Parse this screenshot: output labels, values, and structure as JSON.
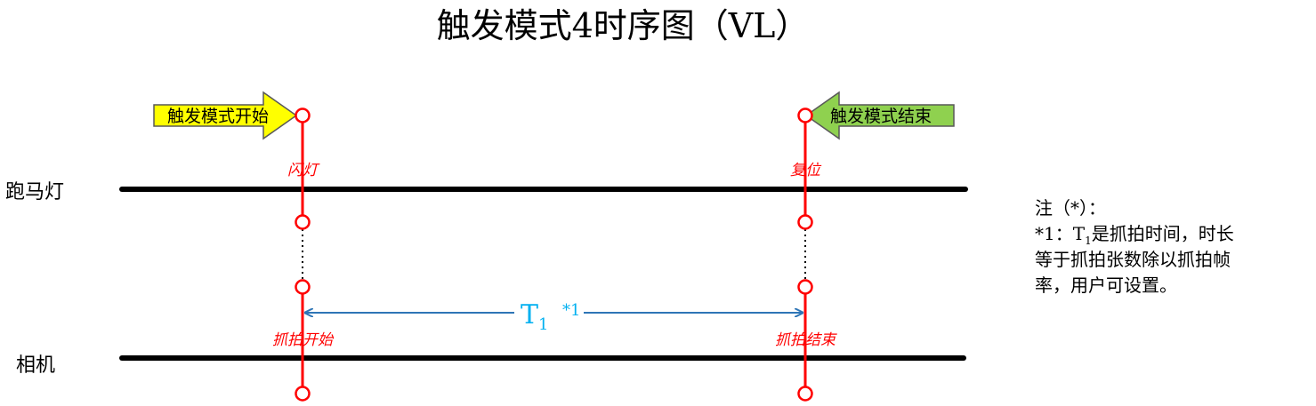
{
  "title": "触发模式4时序图（VL）",
  "arrows": {
    "start": "触发模式开始",
    "end": "触发模式结束"
  },
  "rows": {
    "marquee": "跑马灯",
    "camera": "相机"
  },
  "events": {
    "flash": "闪灯",
    "reset": "复位",
    "capture_start": "抓拍开始",
    "capture_end": "抓拍结束"
  },
  "interval": {
    "symbol": "T",
    "subscript": "1",
    "footnote": "*1"
  },
  "note": {
    "heading": "注（*）：",
    "line1_prefix": "*1：T",
    "line1_sub": "1",
    "line1_suffix": "是抓拍时间，时长",
    "line2": "等于抓拍张数除以抓拍帧",
    "line3": "率，用户可设置。"
  },
  "colors": {
    "timing_red": "#ff0000",
    "interval_blue": "#2e75b6",
    "interval_text_blue": "#00b0f0",
    "start_arrow_fill": "#ffff00",
    "end_arrow_fill": "#8fd14f"
  }
}
